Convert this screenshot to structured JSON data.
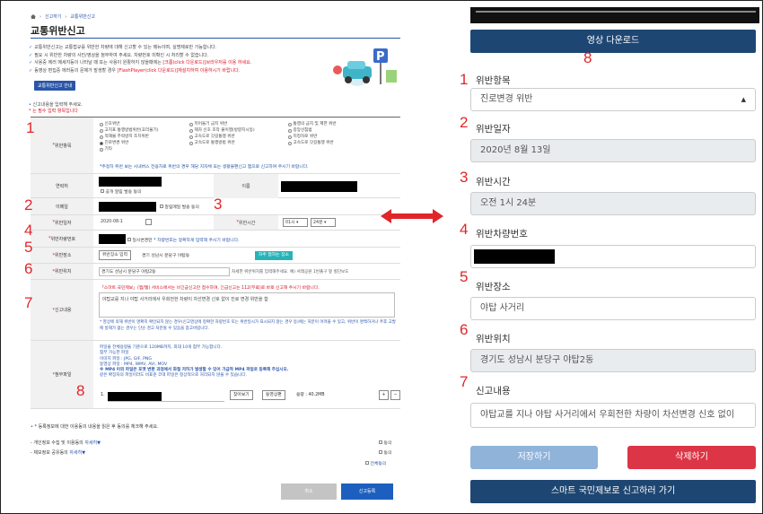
{
  "left_form": {
    "breadcrumb": [
      "신고하기",
      "교통위반신고"
    ],
    "title": "교통위반신고",
    "notices": [
      "교통위반신고는 교통법규를 위반한 차량에 대해 신고할 수 있는 메뉴이며, 실명제로만 가능합니다.",
      "필요 시 위반한 차량의 사진/영상을 첨부하여 주세요. 차량번호 미확인 시 처리할 수 없습니다.",
      "사용중 에러 메세지등이 나타날 때 또는 사용이 원활하지 않을때에는",
      "동영상 편집중 에러등의 문제가 발생할 경우",
      "[크롬(click 다운로드)]브라우저를 이용 하세요.",
      "[FlashPlayer(click 다운로드)]재설치하여 이용하시기 바랍니다."
    ],
    "guide_button": "교통위반신고 안내",
    "required_note_1": "신고내용을 입력해 주세요.",
    "required_note_2": "는 필수 입력 항목입니다",
    "labels": {
      "violation_type": "위반항목",
      "contact": "연락처",
      "name": "이름",
      "email": "이메일",
      "date": "위반일자",
      "time": "위반시간",
      "plate": "위반차량번호",
      "place": "위반장소",
      "location": "위반위치",
      "content": "신고내용",
      "attachment": "첨부파일"
    },
    "violation_options": [
      "신호위반",
      "끼어들기 금지 위반",
      "통행의 금지 및 제한 위반",
      "고지표 통행방법위반(꼬리물기)",
      "제차 신호 조작 불이행(방향지시등)",
      "중앙선침범",
      "적재물 추락방지 조치위반",
      "고속도로 갓길통행 위반",
      "지정차로 위반",
      "진로변경 위반",
      "고속도로 통행방법 위반",
      "고속도로 갓길통행 위반",
      "기타"
    ],
    "violation_selected_index": 9,
    "violation_note": "*주정차 위반 보는 시내버스 전용차로 위반의 경우 해당 지자체 또는 생활불편신고 앱으로 신고하여 주시기 바랍니다.",
    "sms_agree": "공개 알림 발송 동의",
    "email_agree": "알림메일 발송 동의",
    "date_value": "2020-08-1",
    "hour_value": "01시",
    "minute_value": "24분",
    "plate_unknown": "일시변경란",
    "plate_note": "* 차량번호는 정확하게 입력해 주시기 바랍니다.",
    "place_button": "위반장소 입력",
    "place_value": "경기 성남시 분당구 야탑동",
    "frequent_place_button": "자주 접하는 장소",
    "location_value": "경기도 성남시 분당구 야탑2동",
    "location_hint": "자세한 위반위치를 입력해주세요. 예) 서래공원 1번출구 앞 횡단보도",
    "content_notice": "「스마트 국민제보」(앱/웹) 서비스에서는 비긴급신고만 접수하며, 긴급신고는 112(무료)로 바로 신고해 주시기 바랍니다.",
    "content_value": "야탑교를 지나 야탑 사거리에서 우회전한 차량이 차선변경 신호 없이 진로 변경 위반을 함",
    "content_warning": "* 영상에 의해 위반이 명확히 확인되지 않는 경우(신고영상에 정확한 차량번호 또는 위반일시가 표시되지 않는 경우 등)에는 처분이 어려울 수 있고, 위반이 명백하거나 추후 고발에 방해가 없는 경우는 단순 경고 처분될 수 있음을 참고바랍니다.",
    "attach_info": [
      "파일을 전체용량을 기준으로 120MB까지, 최대 10개 첨부 가능합니다.",
      "첨부 가능한 파일",
      "이미지 파일 : JPG, GIF, PNG",
      "동영상 파일 : MP4, WMV, AVI, MOV",
      "※ MP4 이외 파일은 포맷 변환 과정에서 화질 저하가 발생할 수 있어 가급적 MP4 파일로 등록해 주십시오.",
      "같은 확장자의 파일이라도 비표준 코덱 파일은 정상적으로 처리되지 않을 수 있습니다."
    ],
    "attach_index": "1.",
    "browse_button": "찾아보기",
    "video_button": "동영상편",
    "attach_size": "용량 : 40.2MB",
    "consent_intro": "* 등록정보에 대한 이용동의 내용을 읽은 후 동의를 체크해 주세요.",
    "consent_1": "- 개인정보 수집 및 이용동의",
    "consent_2": "- 제보정보 공유동의",
    "detail_link": "자세히▼",
    "agree_1": "동의",
    "agree_2": "동의",
    "agree_all": "전체동의",
    "cancel_button": "취소",
    "submit_button": "신고등록"
  },
  "mobile_form": {
    "download_button": "영상 다운로드",
    "labels": {
      "violation_type": "위반항목",
      "date": "위반일자",
      "time": "위반시간",
      "plate": "위반차량번호",
      "place": "위반장소",
      "location": "위반위치",
      "content": "신고내용"
    },
    "violation_value": "진로변경 위반",
    "date_value": "2020년 8월 13일",
    "time_value": "오전 1시 24분",
    "place_value": "야탑 사거리",
    "location_value": "경기도 성남시 분당구 야탑2동",
    "content_value": "야탑교를 지나 야탑 사거리에서 우회전한 차량이 차선변경 신호 없이",
    "save_button": "저장하기",
    "delete_button": "삭제하기",
    "report_button": "스마트 국민제보로 신고하러 가기"
  },
  "annotations": {
    "left": [
      "1",
      "2",
      "3",
      "4",
      "5",
      "6",
      "7",
      "8"
    ],
    "right": [
      "1",
      "2",
      "3",
      "4",
      "5",
      "6",
      "7",
      "8"
    ]
  },
  "colors": {
    "accent_red": "#e0262a",
    "navy": "#1e4672",
    "delete_red": "#dc3545",
    "save_disabled": "#8fb3d9",
    "teal": "#27b3b8"
  }
}
